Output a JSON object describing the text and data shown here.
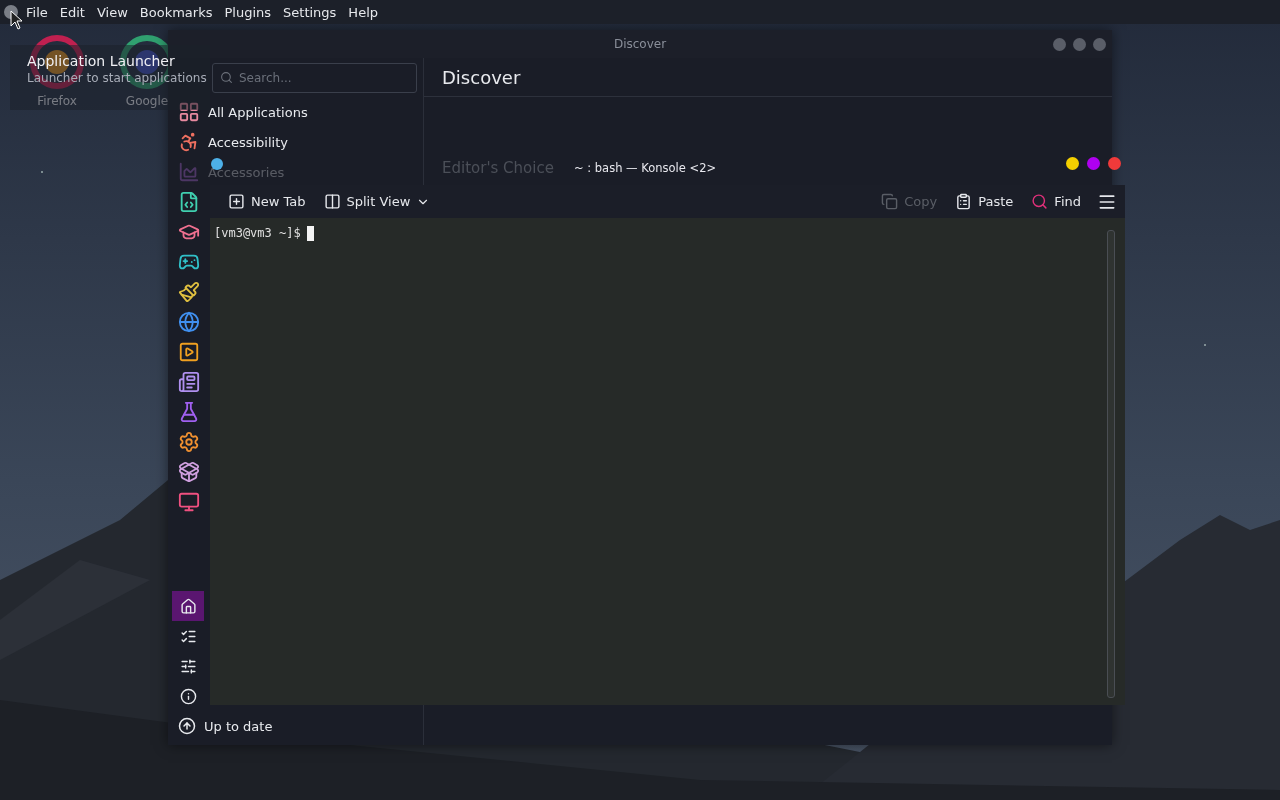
{
  "menu_bar": {
    "items": [
      "File",
      "Edit",
      "View",
      "Bookmarks",
      "Plugins",
      "Settings",
      "Help"
    ]
  },
  "desktop_icons": [
    {
      "label": "Firefox"
    },
    {
      "label": "Google"
    }
  ],
  "tooltip": {
    "title": "Application Launcher",
    "subtitle": "Launcher to start applications"
  },
  "discover": {
    "title": "Discover",
    "search": {
      "placeholder": "Search..."
    },
    "categories": [
      {
        "label": "All Applications"
      },
      {
        "label": "Accessibility"
      },
      {
        "label": "Accessories"
      }
    ],
    "page_title": "Discover",
    "section_title": "Editor's Choice",
    "nav": [
      {
        "kind": "home",
        "selected": true
      },
      {
        "kind": "list",
        "selected": false
      },
      {
        "kind": "settings",
        "selected": false
      },
      {
        "kind": "about",
        "selected": false
      }
    ],
    "update_status": "Up to date"
  },
  "konsole": {
    "title": "~ : bash — Konsole <2>",
    "toolbar": [
      {
        "kind": "new-tab",
        "label": "New Tab",
        "disabled": false
      },
      {
        "kind": "split",
        "label": "Split View",
        "disabled": false
      },
      {
        "kind": "copy",
        "label": "Copy",
        "disabled": true
      },
      {
        "kind": "paste",
        "label": "Paste",
        "disabled": false
      },
      {
        "kind": "find",
        "label": "Find",
        "disabled": false
      }
    ],
    "prompt": "[vm3@vm3 ~]$"
  }
}
